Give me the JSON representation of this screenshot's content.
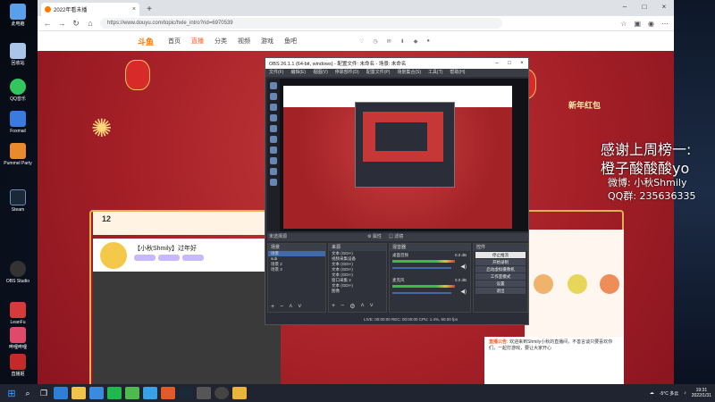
{
  "browser": {
    "tab_title": "2022年看未播",
    "url": "https://www.douyu.com/topic/hxle_intro?rid=6970539",
    "logo": "斗鱼",
    "nav": [
      "首页",
      "直播",
      "分类",
      "视频",
      "游戏",
      "鱼吧"
    ],
    "active_nav": "直播"
  },
  "page": {
    "stat_number": "12",
    "room_title": "【小秋Shmily】过年好",
    "new_year_text": "新年红包",
    "notice_label": "直播公告:",
    "notice_text": "欢迎来到Shmily小秋的直播间，不善言谈只要喜欢你们，一起打游戏，要让大家开心"
  },
  "obs": {
    "title": "OBS 26.1.1 (64-bit, windows) - 配置文件: 未命名 - 场景: 未命名",
    "menu": [
      "文件(F)",
      "编辑(E)",
      "视图(V)",
      "停靠部件(D)",
      "配置文件(P)",
      "场景集合(S)",
      "工具(T)",
      "帮助(H)"
    ],
    "subbar_label": "未选择源",
    "subbar_tabs": [
      "属性",
      "滤镜"
    ],
    "scenes_header": "场景",
    "scenes": [
      "场景",
      "sub",
      "场景 2",
      "场景 3"
    ],
    "sources_header": "来源",
    "sources": [
      "文本 (GDI+)",
      "视频采集设备",
      "文本 (GDI+)",
      "文本 (GDI+)",
      "文本 (GDI+)",
      "窗口采集 2",
      "文本 (GDI+)",
      "图像"
    ],
    "mixer_header": "混音器",
    "mixer": [
      {
        "name": "桌面音频",
        "level": "0.0 dB"
      },
      {
        "name": "麦克风",
        "level": "0.0 dB"
      }
    ],
    "controls_header": "控件",
    "controls": [
      "停止推流",
      "开始录制",
      "启动虚拟摄像机",
      "工作室模式",
      "设置",
      "退出"
    ],
    "bottom_tabs": [
      "控件",
      "转场特效"
    ],
    "status": "LIVE: 00:00:00   REC: 00:00:00   CPU: 1.4%, 60.00 fps"
  },
  "overlay": {
    "line1": "感谢上周榜一:",
    "line2": "橙子酸酸酸yo",
    "line3": "微博: 小秋Shmily",
    "line4": "QQ群: 235636335"
  },
  "desktop": {
    "icons": [
      "此电脑",
      "回收站",
      "QQ音乐",
      "Foxmail",
      "Pummel Party",
      "Steam",
      "OBS Studio",
      "LeanFu",
      "哔哩哔哩",
      "直播姬"
    ]
  },
  "taskbar": {
    "weather": "-5°C 多云",
    "time": "19:31",
    "date": "2022/1/31"
  }
}
